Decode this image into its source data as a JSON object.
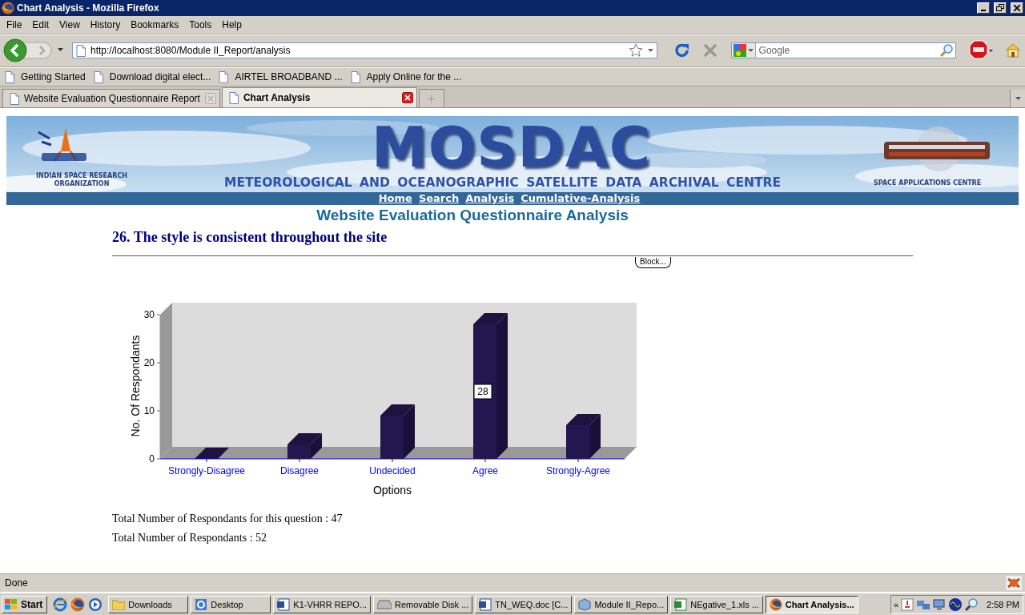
{
  "window": {
    "title": "Chart Analysis - Mozilla Firefox"
  },
  "menu": [
    "File",
    "Edit",
    "View",
    "History",
    "Bookmarks",
    "Tools",
    "Help"
  ],
  "address_bar": {
    "value": "http://localhost:8080/Module II_Report/analysis"
  },
  "search": {
    "placeholder": "Google"
  },
  "bookmarks": [
    "Getting Started",
    "Download digital elect...",
    "AIRTEL BROADBAND ...",
    "Apply Online for the ..."
  ],
  "tabs": [
    {
      "label": "Website Evaluation Questionnaire Report",
      "selected": false
    },
    {
      "label": "Chart Analysis",
      "selected": true
    }
  ],
  "banner": {
    "title": "MOSDAC",
    "subtitle": "METEOROLOGICAL AND OCEANOGRAPHIC SATELLITE DATA ARCHIVAL CENTRE",
    "left_caption": "INDIAN SPACE RESEARCH ORGANIZATION",
    "right_caption": "SPACE APPLICATIONS CENTRE"
  },
  "nav_links": [
    "Home",
    "Search",
    "Analysis",
    "Cumulative-Analysis"
  ],
  "heading": "Website Evaluation Questionnaire Analysis",
  "question": "26. The style is consistent throughout the site",
  "block_tab": "Block...",
  "chart": {
    "chart_data": {
      "type": "bar",
      "xlabel": "Options",
      "ylabel": "No. Of Respondants",
      "categories": [
        "Strongly-Disagree",
        "Disagree",
        "Undecided",
        "Agree",
        "Strongly-Agree"
      ],
      "values": [
        0,
        3,
        9,
        28,
        7
      ],
      "ylim": [
        0,
        30
      ],
      "yticks": [
        0,
        10,
        20,
        30
      ],
      "annotations": [
        "28"
      ]
    }
  },
  "totals": [
    "Total Number of Respondants for this question : 47",
    "Total Number of Respondants : 52"
  ],
  "status_bar": "Done",
  "taskbar": {
    "start": "Start",
    "tasks": [
      {
        "label": "Downloads",
        "kind": "folder",
        "selected": false
      },
      {
        "label": "Desktop",
        "kind": "ie",
        "selected": false
      },
      {
        "label": "K1-VHRR REPO...",
        "kind": "word",
        "selected": false
      },
      {
        "label": "Removable Disk ...",
        "kind": "drive",
        "selected": false
      },
      {
        "label": "TN_WEQ.doc [C...",
        "kind": "word",
        "selected": false
      },
      {
        "label": "Module II_Repo...",
        "kind": "cube",
        "selected": false
      },
      {
        "label": "NEgative_1.xls  ...",
        "kind": "excel",
        "selected": false
      },
      {
        "label": "Chart Analysis...",
        "kind": "firefox",
        "selected": true
      }
    ],
    "tray_toggle": "«",
    "clock": "2:58 PM"
  }
}
